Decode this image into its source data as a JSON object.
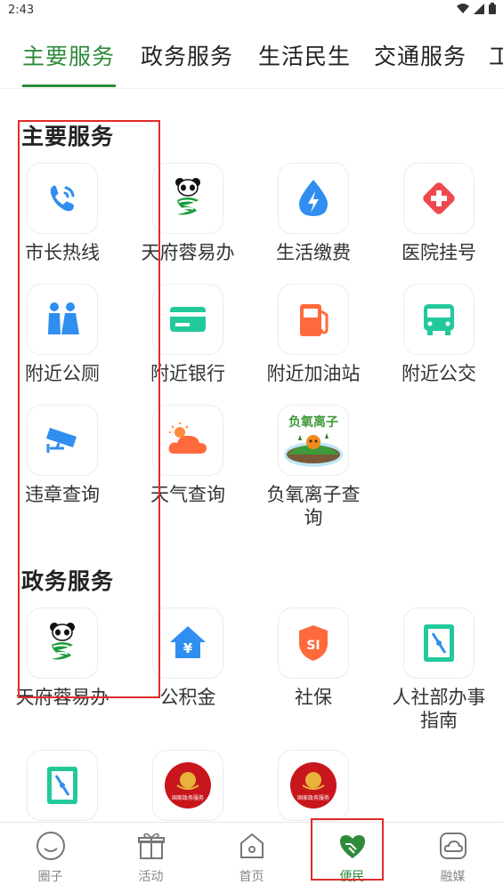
{
  "status": {
    "time": "2:43"
  },
  "tabs": [
    {
      "label": "主要服务",
      "active": true
    },
    {
      "label": "政务服务"
    },
    {
      "label": "生活民生"
    },
    {
      "label": "交通服务"
    },
    {
      "label": "工"
    }
  ],
  "sections": {
    "main": {
      "title": "主要服务",
      "items": [
        {
          "label": "市长热线",
          "icon": "phone-icon"
        },
        {
          "label": "天府蓉易办",
          "icon": "panda-icon"
        },
        {
          "label": "生活缴费",
          "icon": "water-drop-icon"
        },
        {
          "label": "医院挂号",
          "icon": "medical-cross-icon"
        },
        {
          "label": "附近公厕",
          "icon": "restroom-icon"
        },
        {
          "label": "附近银行",
          "icon": "bank-card-icon"
        },
        {
          "label": "附近加油站",
          "icon": "fuel-station-icon"
        },
        {
          "label": "附近公交",
          "icon": "bus-icon"
        },
        {
          "label": "违章查询",
          "icon": "camera-icon"
        },
        {
          "label": "天气查询",
          "icon": "weather-icon"
        },
        {
          "label": "负氧离子查询",
          "icon": "negative-oxygen-badge-icon",
          "badge_text": "负氧离子"
        }
      ]
    },
    "gov": {
      "title": "政务服务",
      "items": [
        {
          "label": "天府蓉易办",
          "icon": "panda-icon"
        },
        {
          "label": "公积金",
          "icon": "house-fund-icon"
        },
        {
          "label": "社保",
          "icon": "social-security-icon",
          "badge_text": "SI"
        },
        {
          "label": "人社部办事指南",
          "icon": "compass-guide-icon"
        },
        {
          "label": "",
          "icon": "compass-guide-icon"
        },
        {
          "label": "",
          "icon": "national-emblem-icon",
          "badge_text": "国家政务服务"
        },
        {
          "label": "",
          "icon": "national-emblem-icon",
          "badge_text": "国家政务服务"
        }
      ]
    }
  },
  "bottom_nav": [
    {
      "label": "圈子",
      "icon": "smiley-icon"
    },
    {
      "label": "活动",
      "icon": "gift-icon"
    },
    {
      "label": "首页",
      "icon": "home-icon"
    },
    {
      "label": "便民",
      "icon": "handshake-heart-icon",
      "active": true
    },
    {
      "label": "融媒",
      "icon": "cloud-icon"
    }
  ],
  "colors": {
    "brand_green": "#2e8b3a",
    "annotation_red": "#e02b2b",
    "icon_blue": "#2f8ef0",
    "icon_red": "#f0484f",
    "icon_orange": "#ff6a3d",
    "icon_teal": "#23c99a"
  }
}
